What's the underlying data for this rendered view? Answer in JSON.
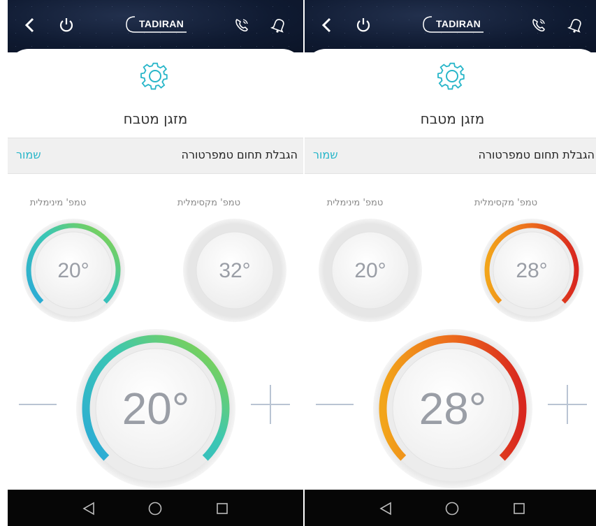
{
  "brand": "TADIRAN",
  "screens": [
    {
      "device_name": "מזגן מטבח",
      "section_title": "הגבלת תחום טמפרטורה",
      "save_label": "שמור",
      "max_label": "טמפ' מקסימלית",
      "min_label": "טמפ' מינימלית",
      "min_temp": "20°",
      "max_temp": "32°",
      "main_temp": "20°",
      "active_scheme": "cool"
    },
    {
      "device_name": "מזגן מטבח",
      "section_title": "הגבלת תחום טמפרטורה",
      "save_label": "שמור",
      "max_label": "טמפ' מקסימלית",
      "min_label": "טמפ' מינימלית",
      "min_temp": "20°",
      "max_temp": "28°",
      "main_temp": "28°",
      "active_scheme": "warm"
    }
  ],
  "colors": {
    "accent": "#28b6c9",
    "cool_gradient": [
      "#2aa9d8",
      "#3cc7b3",
      "#8fd43a"
    ],
    "warm_gradient": [
      "#f2a51a",
      "#ec6a1c",
      "#d8261f"
    ]
  }
}
